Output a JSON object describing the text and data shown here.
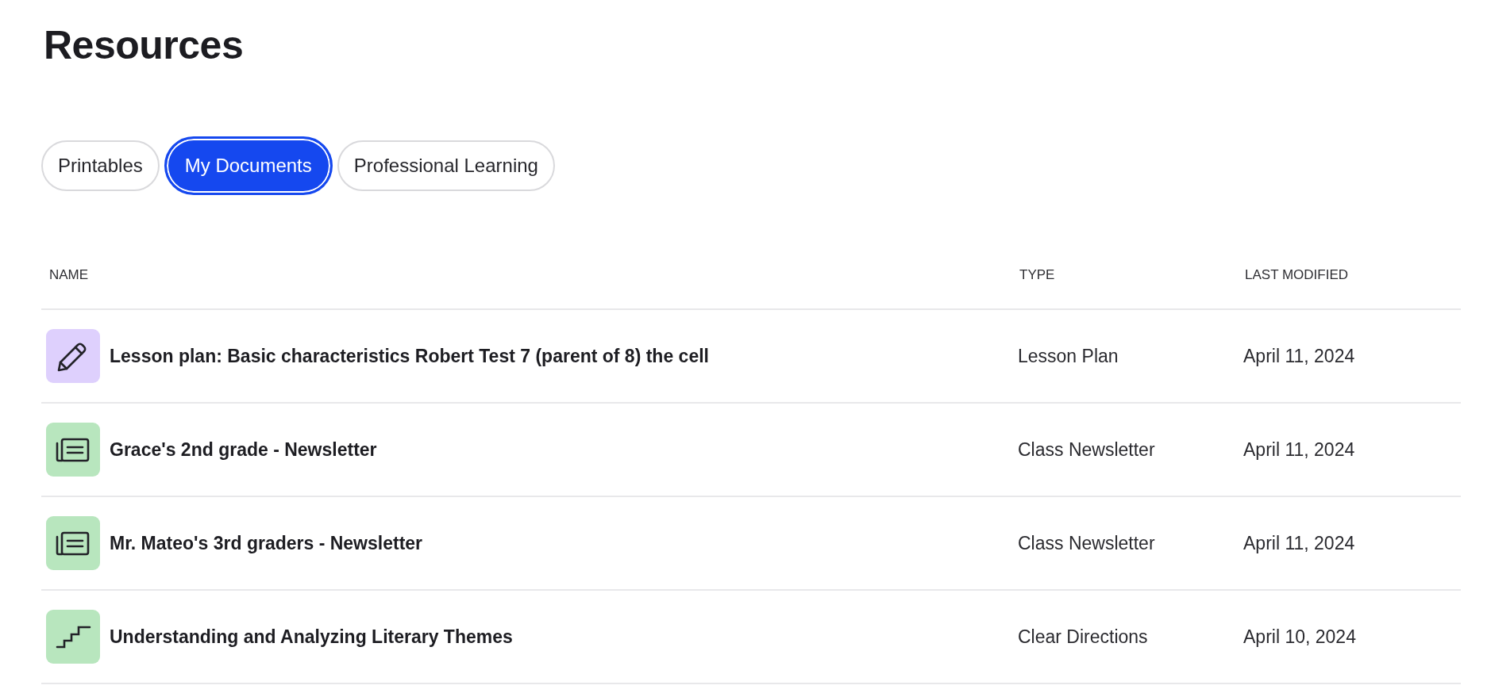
{
  "page": {
    "title": "Resources"
  },
  "tabs": [
    {
      "label": "Printables",
      "selected": false
    },
    {
      "label": "My Documents",
      "selected": true
    },
    {
      "label": "Professional Learning",
      "selected": false
    }
  ],
  "table": {
    "columns": [
      "NAME",
      "TYPE",
      "LAST MODIFIED"
    ],
    "rows": [
      {
        "kind": "plan",
        "color": "#ded0fd",
        "name": "Lesson plan: Basic characteristics Robert Test 7 (parent of 8) the cell",
        "type": "Lesson Plan",
        "last_modified": "April 11, 2024"
      },
      {
        "kind": "newsletter",
        "color": "#b8e6be",
        "name": "Grace's 2nd grade - Newsletter",
        "type": "Class Newsletter",
        "last_modified": "April 11, 2024"
      },
      {
        "kind": "newsletter",
        "color": "#b8e6be",
        "name": "Mr. Mateo's 3rd graders - Newsletter",
        "type": "Class Newsletter",
        "last_modified": "April 11, 2024"
      },
      {
        "kind": "directions",
        "color": "#b8e6be",
        "name": "Understanding and Analyzing Literary Themes",
        "type": "Clear Directions",
        "last_modified": "April 10, 2024"
      }
    ]
  }
}
